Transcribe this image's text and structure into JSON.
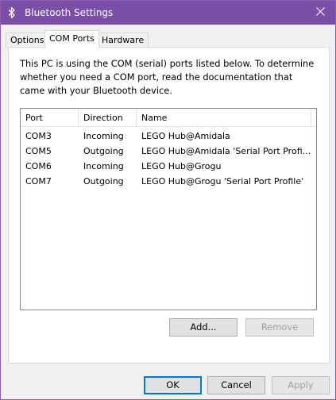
{
  "window": {
    "title": "Bluetooth Settings",
    "icons": {
      "app": "bluetooth-icon",
      "close": "close-icon"
    }
  },
  "tabs": [
    {
      "label": "Options",
      "active": false
    },
    {
      "label": "COM Ports",
      "active": true
    },
    {
      "label": "Hardware",
      "active": false
    }
  ],
  "com_ports": {
    "description": "This PC is using the COM (serial) ports listed below. To determine whether you need a COM port, read the documentation that came with your Bluetooth device.",
    "columns": [
      "Port",
      "Direction",
      "Name"
    ],
    "rows": [
      {
        "port": "COM3",
        "direction": "Incoming",
        "name": "LEGO Hub@Amidala"
      },
      {
        "port": "COM5",
        "direction": "Outgoing",
        "name": "LEGO Hub@Amidala 'Serial Port Profi..."
      },
      {
        "port": "COM6",
        "direction": "Incoming",
        "name": "LEGO Hub@Grogu"
      },
      {
        "port": "COM7",
        "direction": "Outgoing",
        "name": "LEGO Hub@Grogu 'Serial Port Profile'"
      }
    ],
    "add_label": "Add...",
    "remove_label": "Remove"
  },
  "footer": {
    "ok_label": "OK",
    "cancel_label": "Cancel",
    "apply_label": "Apply"
  },
  "colors": {
    "titlebar": "#7b4fa8",
    "accent": "#0078d7"
  }
}
